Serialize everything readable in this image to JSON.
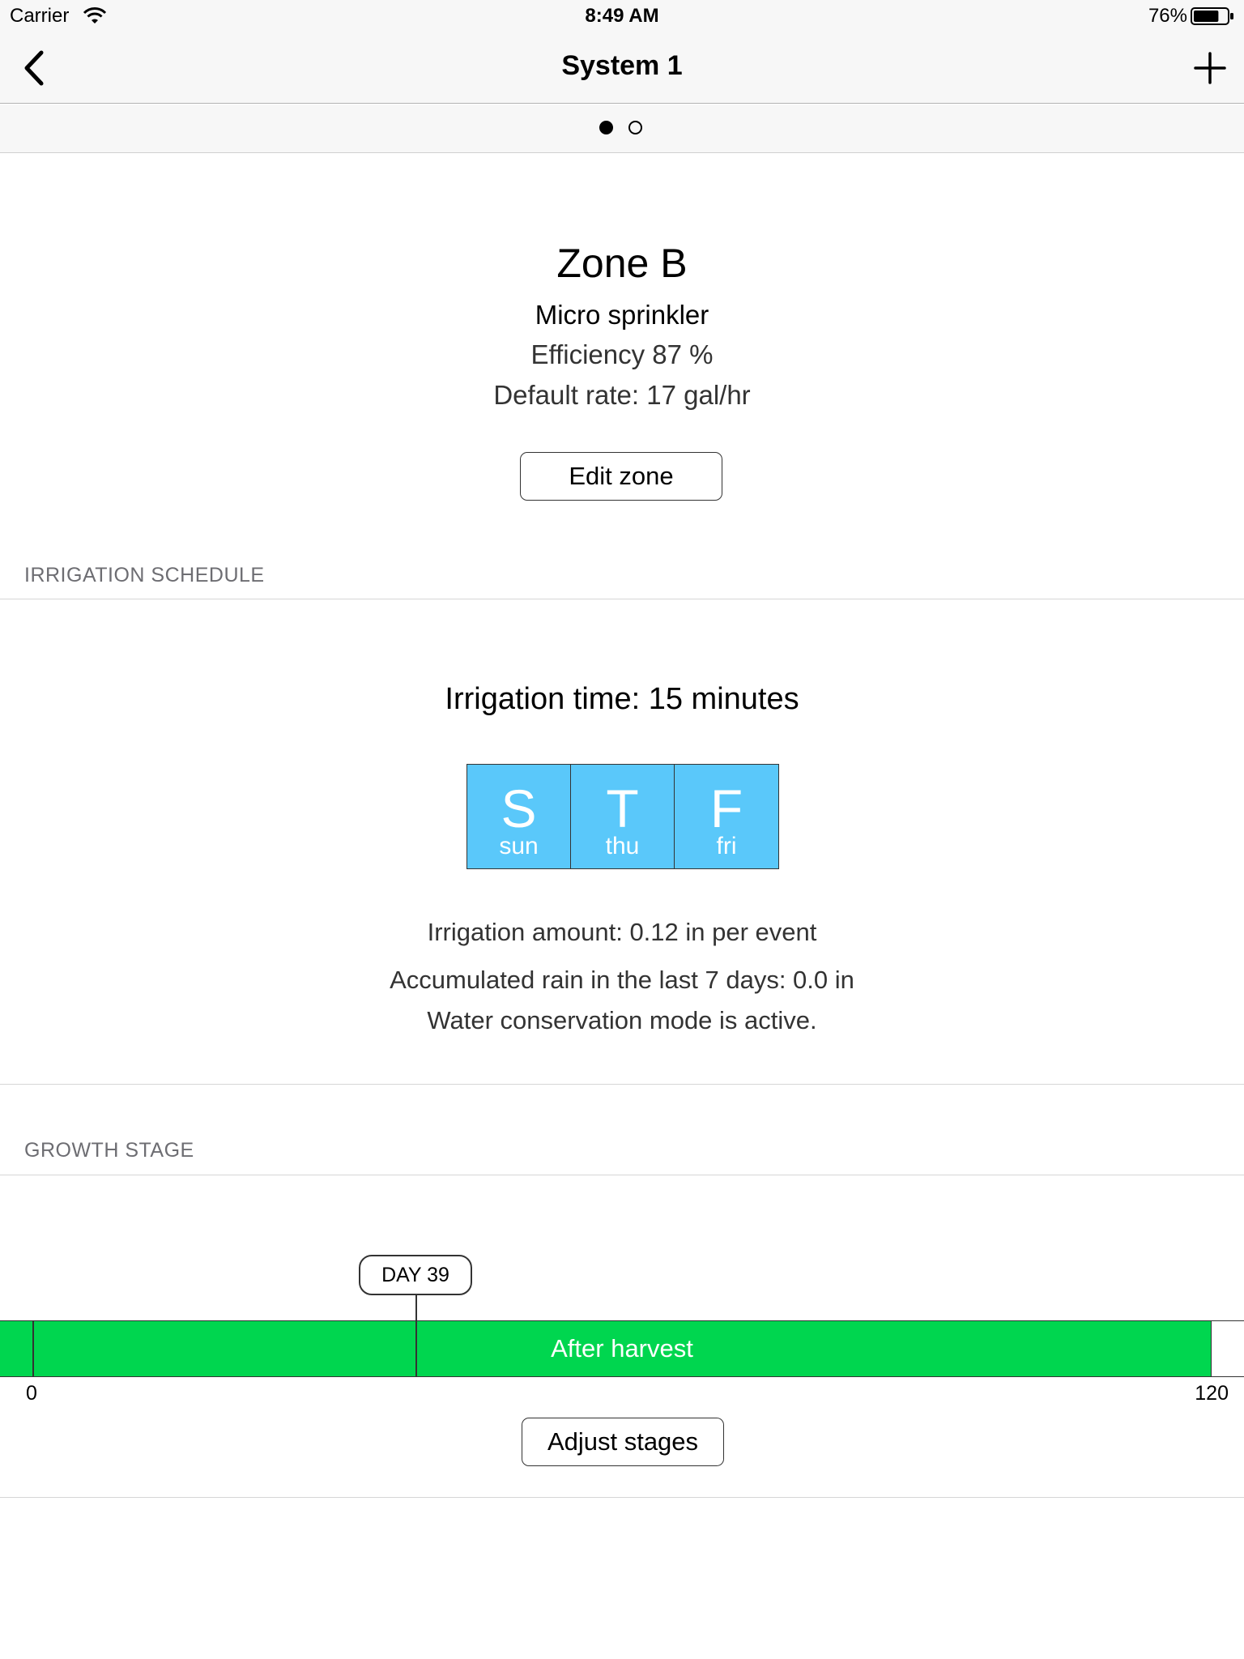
{
  "status_bar": {
    "carrier": "Carrier",
    "time": "8:49 AM",
    "battery": "76%",
    "battery_level": 0.76,
    "icons": [
      "wifi-icon",
      "battery-icon"
    ]
  },
  "nav": {
    "title": "System 1",
    "back_icon": "chevron-left-icon",
    "add_icon": "plus-icon"
  },
  "pager": {
    "page_count": 2,
    "current_page": 1
  },
  "zone": {
    "name": "Zone B",
    "type": "Micro sprinkler",
    "efficiency": "Efficiency 87 %",
    "default_rate": "Default rate: 17 gal/hr",
    "edit_label": "Edit zone"
  },
  "irrigation": {
    "header": "IRRIGATION SCHEDULE",
    "time": "Irrigation time: 15 minutes",
    "days": [
      {
        "letter": "S",
        "name": "sun"
      },
      {
        "letter": "T",
        "name": "thu"
      },
      {
        "letter": "F",
        "name": "fri"
      }
    ],
    "amount": "Irrigation amount: 0.12 in per event",
    "rain": "Accumulated rain in the last 7 days: 0.0 in",
    "mode": "Water conservation mode is active.",
    "day_color": "#5ac8fa"
  },
  "growth": {
    "header": "GROWTH STAGE",
    "marker": "DAY 39",
    "current_day": 39,
    "stage_label": "After harvest",
    "axis_min": "0",
    "axis_max": "120",
    "stage_color": "#00d64f",
    "adjust_label": "Adjust stages"
  }
}
